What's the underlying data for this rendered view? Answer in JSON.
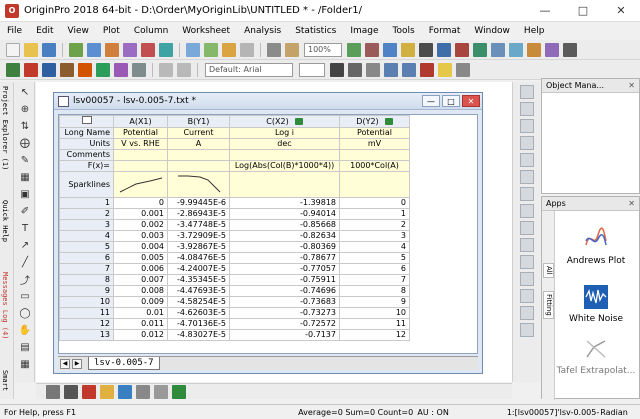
{
  "window": {
    "title": "OriginPro 2018 64-bit - D:\\Order\\MyOriginLib\\UNTITLED * - /Folder1/",
    "app_icon": "o-logo-icon"
  },
  "menu": [
    "File",
    "Edit",
    "View",
    "Plot",
    "Column",
    "Worksheet",
    "Analysis",
    "Statistics",
    "Image",
    "Tools",
    "Format",
    "Window",
    "Help"
  ],
  "toolbar": {
    "zoom": "100%",
    "font_placeholder": "Default: Arial"
  },
  "left_dock": [
    "Project Explorer (1)",
    "Quick Help",
    "Messages Log (4)",
    "Smart"
  ],
  "worksheet": {
    "title": "lsv00057 - lsv-0.005-7.txt *",
    "columns": [
      "A(X1)",
      "B(Y1)",
      "C(X2)",
      "D(Y2)"
    ],
    "meta_rows": [
      {
        "label": "Long Name",
        "values": [
          "Potential",
          "Current",
          "Log i",
          "Potential"
        ]
      },
      {
        "label": "Units",
        "values": [
          "V vs. RHE",
          "A",
          "dec",
          "mV"
        ]
      },
      {
        "label": "Comments",
        "values": [
          "",
          "",
          "",
          ""
        ]
      },
      {
        "label": "F(x)=",
        "values": [
          "",
          "",
          "Log(Abs(Col(B)*1000*4))",
          "1000*Col(A)"
        ]
      }
    ],
    "sparklines_label": "Sparklines",
    "rows": [
      {
        "n": "1",
        "a": "0",
        "b": "-9.99445E-6",
        "c": "-1.39818",
        "d": "0"
      },
      {
        "n": "2",
        "a": "0.001",
        "b": "-2.86943E-5",
        "c": "-0.94014",
        "d": "1"
      },
      {
        "n": "3",
        "a": "0.002",
        "b": "-3.47748E-5",
        "c": "-0.85668",
        "d": "2"
      },
      {
        "n": "4",
        "a": "0.003",
        "b": "-3.72909E-5",
        "c": "-0.82634",
        "d": "3"
      },
      {
        "n": "5",
        "a": "0.004",
        "b": "-3.92867E-5",
        "c": "-0.80369",
        "d": "4"
      },
      {
        "n": "6",
        "a": "0.005",
        "b": "-4.08476E-5",
        "c": "-0.78677",
        "d": "5"
      },
      {
        "n": "7",
        "a": "0.006",
        "b": "-4.24007E-5",
        "c": "-0.77057",
        "d": "6"
      },
      {
        "n": "8",
        "a": "0.007",
        "b": "-4.35345E-5",
        "c": "-0.75911",
        "d": "7"
      },
      {
        "n": "9",
        "a": "0.008",
        "b": "-4.47693E-5",
        "c": "-0.74696",
        "d": "8"
      },
      {
        "n": "10",
        "a": "0.009",
        "b": "-4.58254E-5",
        "c": "-0.73683",
        "d": "9"
      },
      {
        "n": "11",
        "a": "0.01",
        "b": "-4.62603E-5",
        "c": "-0.73273",
        "d": "10"
      },
      {
        "n": "12",
        "a": "0.011",
        "b": "-4.70136E-5",
        "c": "-0.72572",
        "d": "11"
      },
      {
        "n": "13",
        "a": "0.012",
        "b": "-4.83027E-5",
        "c": "-0.7137",
        "d": "12"
      }
    ],
    "sheet_tab": "lsv-0.005-7"
  },
  "object_manager": {
    "title": "Object Mana..."
  },
  "apps_panel": {
    "title": "Apps",
    "side_tabs": [
      "All",
      "Fitting"
    ],
    "apps": [
      "Andrews Plot",
      "White Noise",
      "Tafel Extrapolat..."
    ]
  },
  "status": {
    "left": "For Help, press F1",
    "stats": "Average=0 Sum=0 Count=0",
    "au": "AU : ON",
    "sheet": "1:[lsv00057]'lsv-0.005-7'!",
    "angle": "Radian"
  },
  "colors": {
    "accent": "#2f8a3c",
    "meta_bg": "#fffed6",
    "header_bg": "#e9eef6"
  }
}
